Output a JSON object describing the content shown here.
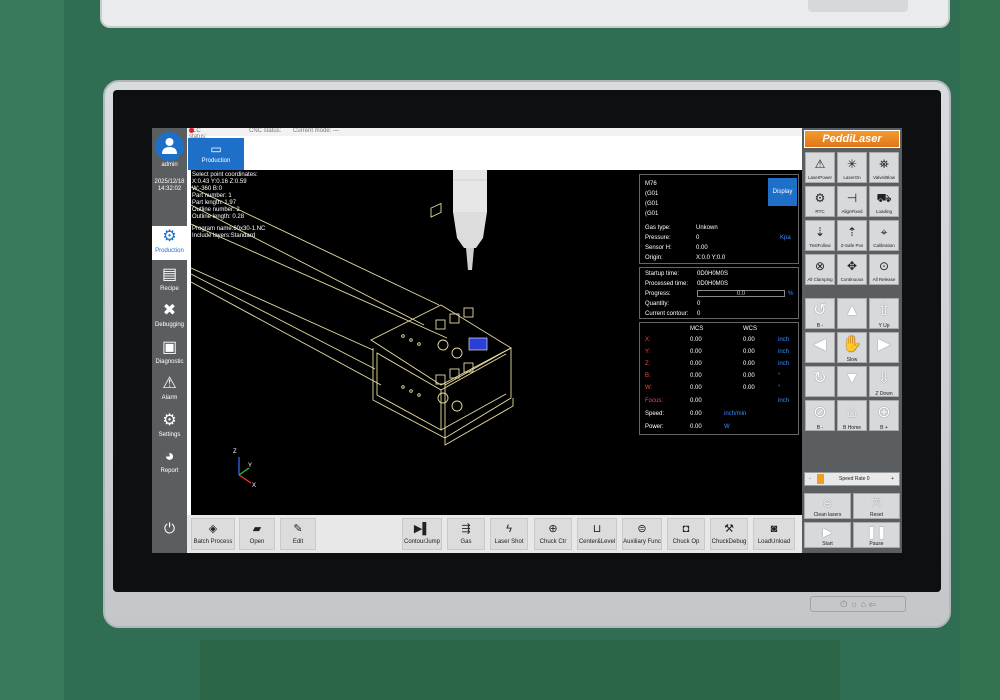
{
  "hardware": {
    "buttons": "⏻ ☼ ⌂ ⇦"
  },
  "sidebar": {
    "user": "admin",
    "date": "2025/12/18",
    "time": "14:32:02",
    "items": [
      {
        "label": "Production",
        "icon": "gears-icon"
      },
      {
        "label": "Recipe",
        "icon": "document-icon"
      },
      {
        "label": "Debugging",
        "icon": "tools-icon"
      },
      {
        "label": "Diagnostic",
        "icon": "monitor-icon"
      },
      {
        "label": "Alarm",
        "icon": "warning-icon"
      },
      {
        "label": "Settings",
        "icon": "gear-icon"
      },
      {
        "label": "Report",
        "icon": "pie-icon"
      }
    ]
  },
  "status": {
    "plc": "PLC status:",
    "cnc": "CNC status:",
    "mode": "Current mode: —"
  },
  "tab": {
    "label": "Production"
  },
  "overlay": {
    "lines": [
      "Select point coordinates:",
      " X:0.43 Y:0.16 Z:0.59",
      "W:-360 B:0",
      "Part number: 1",
      "Part length: 1.97",
      "Outline number: 2",
      "Outline length: 0.28"
    ],
    "program": "Program name:60x30-1.NC",
    "layers": "Include layers:Standard"
  },
  "gcode": {
    "lines": [
      "M76",
      "(G01",
      "(G01",
      "(G01"
    ],
    "display_label": "Display",
    "gas_type_label": "Gas type:",
    "gas_type": "Unkown",
    "pressure_label": "Pressure:",
    "pressure": "0",
    "pressure_unit": "Kpa",
    "sensor_label": "Sensor H:",
    "sensor": "0.00",
    "origin_label": "Origin:",
    "origin": "X:0.0 Y:0.0"
  },
  "process": {
    "startup_label": "Startup time:",
    "startup": "0D0H0M0S",
    "processed_label": "Processed time:",
    "processed": "0D0H0M0S",
    "progress_label": "Progress:",
    "progress": "0.0",
    "progress_unit": "%",
    "quantity_label": "Quantity:",
    "quantity": "0",
    "contour_label": "Current contour:",
    "contour": "0"
  },
  "coords": {
    "mcs": "MCS",
    "wcs": "WCS",
    "rows": [
      {
        "axis": "X:",
        "mcs": "0.00",
        "wcs": "0.00",
        "unit": "inch"
      },
      {
        "axis": "Y:",
        "mcs": "0.00",
        "wcs": "0.00",
        "unit": "inch"
      },
      {
        "axis": "Z:",
        "mcs": "0.00",
        "wcs": "0.00",
        "unit": "inch"
      },
      {
        "axis": "B:",
        "mcs": "0.00",
        "wcs": "0.00",
        "unit": "°"
      },
      {
        "axis": "W:",
        "mcs": "0.00",
        "wcs": "0.00",
        "unit": "°"
      }
    ],
    "focus_label": "Focus:",
    "focus": "0.00",
    "focus_unit": "inch",
    "speed_label": "Speed:",
    "speed": "0.00",
    "speed_unit": "inch/min",
    "power_label": "Power:",
    "power": "0.00",
    "power_unit": "W"
  },
  "axes": {
    "z": "Z",
    "y": "Y",
    "x": "X"
  },
  "bottom": [
    {
      "label": "Batch Process",
      "icon": "stack-icon"
    },
    {
      "label": "Open",
      "icon": "folder-icon"
    },
    {
      "label": "Edit",
      "icon": "edit-icon"
    },
    {
      "label": "ContourJump",
      "icon": "jump-icon"
    },
    {
      "label": "Gas",
      "icon": "gas-icon"
    },
    {
      "label": "Laser Shot",
      "icon": "laser-shot-icon"
    },
    {
      "label": "Chuck Ctr",
      "icon": "crosshair-icon"
    },
    {
      "label": "Center&Level",
      "icon": "center-level-icon"
    },
    {
      "label": "Auxiliary Func",
      "icon": "auxiliary-icon"
    },
    {
      "label": "Chuck Op",
      "icon": "chuck-op-icon"
    },
    {
      "label": "ChuckDebug",
      "icon": "chuck-debug-icon"
    },
    {
      "label": "LoadUnload",
      "icon": "load-unload-icon"
    }
  ],
  "right": {
    "brand": "PeddiLaser",
    "buttons": [
      "LaserPower",
      "LaserOn",
      "Valve/Blow",
      "RTC",
      "AlignFixed",
      "Loading",
      "TestFollow",
      "Z-Safe Pos",
      "Calibration",
      "All Clamping",
      "Continuous",
      "All Release"
    ],
    "jog": {
      "b_minus": "B -",
      "y_up": "Y Up",
      "slow": "Slow",
      "z_down": "Z Down",
      "b_home": "B Home",
      "b_plus": "B +"
    },
    "speed_rate": {
      "minus": "-",
      "label": "Speed Rate 0",
      "plus": "+"
    },
    "clean": "Clean lasers",
    "reset": "Reset",
    "start": "Start",
    "pause": "Pause"
  }
}
